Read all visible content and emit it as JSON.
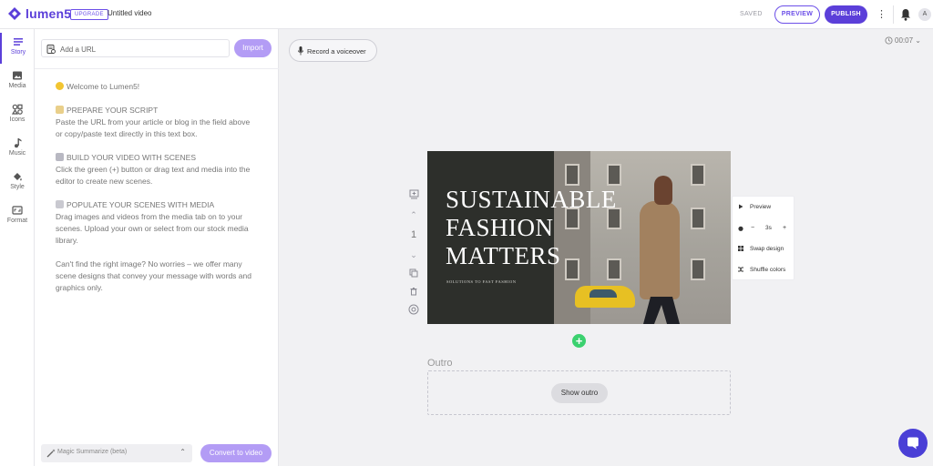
{
  "header": {
    "logo_text": "lumen5",
    "upgrade_label": "UPGRADE",
    "doc_title": "Untitled video",
    "saved_status": "SAVED",
    "preview_label": "PREVIEW",
    "publish_label": "PUBLISH",
    "avatar_initial": "A"
  },
  "rail": {
    "items": [
      {
        "label": "Story",
        "icon": "story-icon"
      },
      {
        "label": "Media",
        "icon": "media-icon"
      },
      {
        "label": "Icons",
        "icon": "shapes-icon"
      },
      {
        "label": "Music",
        "icon": "music-note-icon"
      },
      {
        "label": "Style",
        "icon": "paint-bucket-icon"
      },
      {
        "label": "Format",
        "icon": "aspect-ratio-icon"
      }
    ]
  },
  "story": {
    "url_placeholder": "Add a URL",
    "import_label": "Import",
    "welcome": "Welcome to Lumen5!",
    "sections": [
      {
        "heading": "PREPARE YOUR SCRIPT",
        "body": "Paste the URL from your article or blog in the field above or copy/paste text directly in this text box."
      },
      {
        "heading": "BUILD YOUR VIDEO WITH SCENES",
        "body": "Click the green (+) button or drag text and media into the editor to create new scenes."
      },
      {
        "heading": "POPULATE YOUR SCENES WITH MEDIA",
        "body": "Drag images and videos from the media tab on to your scenes. Upload your own or select from our stock media library."
      }
    ],
    "closing": "Can't find the right image? No worries – we offer many scene designs that convey your message with words and graphics only.",
    "magic_label": "Magic Summarize (beta)",
    "convert_label": "Convert to video"
  },
  "canvas": {
    "voiceover_label": "Record a voiceover",
    "duration_total": "00:07",
    "scene_number": "1",
    "scene": {
      "title_line1": "SUSTAINABLE",
      "title_line2": "FASHION",
      "title_line3": "MATTERS",
      "subtitle": "SOLUTIONS TO FAST FASHION"
    },
    "scene_menu": {
      "preview_label": "Preview",
      "duration_minus": "−",
      "duration_value": "3s",
      "duration_plus": "+",
      "swap_label": "Swap design",
      "shuffle_label": "Shuffle colors"
    },
    "add_scene": "+",
    "outro_title": "Outro",
    "show_outro_label": "Show outro"
  },
  "colors": {
    "brand": "#5b3fd9",
    "accent_light": "#b39cf5",
    "add_green": "#3bd16f"
  }
}
